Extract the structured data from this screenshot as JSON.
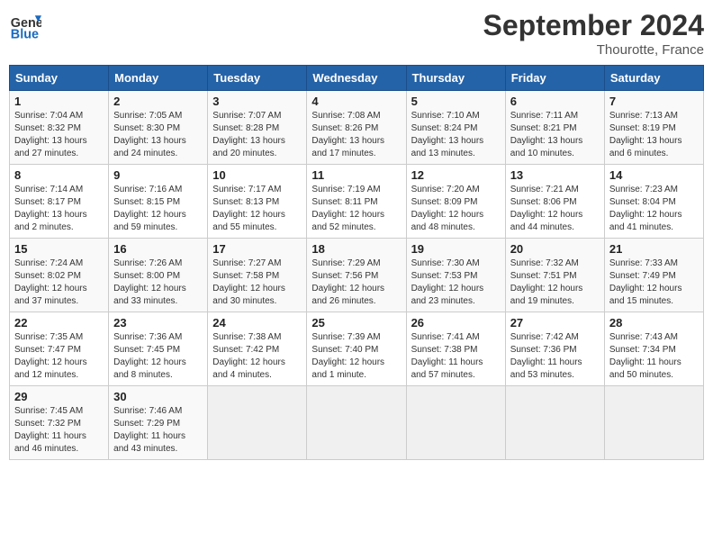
{
  "header": {
    "logo_text_general": "General",
    "logo_text_blue": "Blue",
    "month_title": "September 2024",
    "location": "Thourotte, France"
  },
  "calendar": {
    "days_of_week": [
      "Sunday",
      "Monday",
      "Tuesday",
      "Wednesday",
      "Thursday",
      "Friday",
      "Saturday"
    ],
    "weeks": [
      [
        null,
        {
          "day": "2",
          "info": "Sunrise: 7:05 AM\nSunset: 8:30 PM\nDaylight: 13 hours\nand 24 minutes."
        },
        {
          "day": "3",
          "info": "Sunrise: 7:07 AM\nSunset: 8:28 PM\nDaylight: 13 hours\nand 20 minutes."
        },
        {
          "day": "4",
          "info": "Sunrise: 7:08 AM\nSunset: 8:26 PM\nDaylight: 13 hours\nand 17 minutes."
        },
        {
          "day": "5",
          "info": "Sunrise: 7:10 AM\nSunset: 8:24 PM\nDaylight: 13 hours\nand 13 minutes."
        },
        {
          "day": "6",
          "info": "Sunrise: 7:11 AM\nSunset: 8:21 PM\nDaylight: 13 hours\nand 10 minutes."
        },
        {
          "day": "7",
          "info": "Sunrise: 7:13 AM\nSunset: 8:19 PM\nDaylight: 13 hours\nand 6 minutes."
        }
      ],
      [
        {
          "day": "1",
          "info": "Sunrise: 7:04 AM\nSunset: 8:32 PM\nDaylight: 13 hours\nand 27 minutes."
        },
        null,
        null,
        null,
        null,
        null,
        null
      ],
      [
        {
          "day": "8",
          "info": "Sunrise: 7:14 AM\nSunset: 8:17 PM\nDaylight: 13 hours\nand 2 minutes."
        },
        {
          "day": "9",
          "info": "Sunrise: 7:16 AM\nSunset: 8:15 PM\nDaylight: 12 hours\nand 59 minutes."
        },
        {
          "day": "10",
          "info": "Sunrise: 7:17 AM\nSunset: 8:13 PM\nDaylight: 12 hours\nand 55 minutes."
        },
        {
          "day": "11",
          "info": "Sunrise: 7:19 AM\nSunset: 8:11 PM\nDaylight: 12 hours\nand 52 minutes."
        },
        {
          "day": "12",
          "info": "Sunrise: 7:20 AM\nSunset: 8:09 PM\nDaylight: 12 hours\nand 48 minutes."
        },
        {
          "day": "13",
          "info": "Sunrise: 7:21 AM\nSunset: 8:06 PM\nDaylight: 12 hours\nand 44 minutes."
        },
        {
          "day": "14",
          "info": "Sunrise: 7:23 AM\nSunset: 8:04 PM\nDaylight: 12 hours\nand 41 minutes."
        }
      ],
      [
        {
          "day": "15",
          "info": "Sunrise: 7:24 AM\nSunset: 8:02 PM\nDaylight: 12 hours\nand 37 minutes."
        },
        {
          "day": "16",
          "info": "Sunrise: 7:26 AM\nSunset: 8:00 PM\nDaylight: 12 hours\nand 33 minutes."
        },
        {
          "day": "17",
          "info": "Sunrise: 7:27 AM\nSunset: 7:58 PM\nDaylight: 12 hours\nand 30 minutes."
        },
        {
          "day": "18",
          "info": "Sunrise: 7:29 AM\nSunset: 7:56 PM\nDaylight: 12 hours\nand 26 minutes."
        },
        {
          "day": "19",
          "info": "Sunrise: 7:30 AM\nSunset: 7:53 PM\nDaylight: 12 hours\nand 23 minutes."
        },
        {
          "day": "20",
          "info": "Sunrise: 7:32 AM\nSunset: 7:51 PM\nDaylight: 12 hours\nand 19 minutes."
        },
        {
          "day": "21",
          "info": "Sunrise: 7:33 AM\nSunset: 7:49 PM\nDaylight: 12 hours\nand 15 minutes."
        }
      ],
      [
        {
          "day": "22",
          "info": "Sunrise: 7:35 AM\nSunset: 7:47 PM\nDaylight: 12 hours\nand 12 minutes."
        },
        {
          "day": "23",
          "info": "Sunrise: 7:36 AM\nSunset: 7:45 PM\nDaylight: 12 hours\nand 8 minutes."
        },
        {
          "day": "24",
          "info": "Sunrise: 7:38 AM\nSunset: 7:42 PM\nDaylight: 12 hours\nand 4 minutes."
        },
        {
          "day": "25",
          "info": "Sunrise: 7:39 AM\nSunset: 7:40 PM\nDaylight: 12 hours\nand 1 minute."
        },
        {
          "day": "26",
          "info": "Sunrise: 7:41 AM\nSunset: 7:38 PM\nDaylight: 11 hours\nand 57 minutes."
        },
        {
          "day": "27",
          "info": "Sunrise: 7:42 AM\nSunset: 7:36 PM\nDaylight: 11 hours\nand 53 minutes."
        },
        {
          "day": "28",
          "info": "Sunrise: 7:43 AM\nSunset: 7:34 PM\nDaylight: 11 hours\nand 50 minutes."
        }
      ],
      [
        {
          "day": "29",
          "info": "Sunrise: 7:45 AM\nSunset: 7:32 PM\nDaylight: 11 hours\nand 46 minutes."
        },
        {
          "day": "30",
          "info": "Sunrise: 7:46 AM\nSunset: 7:29 PM\nDaylight: 11 hours\nand 43 minutes."
        },
        null,
        null,
        null,
        null,
        null
      ]
    ]
  }
}
